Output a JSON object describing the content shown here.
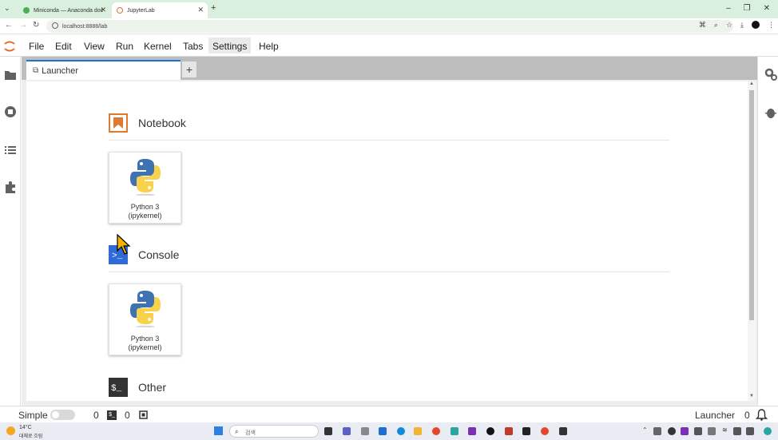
{
  "browser": {
    "tabs": [
      {
        "title": "Miniconda — Anaconda doc"
      },
      {
        "title": "JupyterLab"
      }
    ],
    "url": "localhost:8888/lab"
  },
  "menubar": {
    "items": [
      "File",
      "Edit",
      "View",
      "Run",
      "Kernel",
      "Tabs",
      "Settings",
      "Help"
    ]
  },
  "dock": {
    "tab_label": "Launcher",
    "add_tab": "+"
  },
  "launcher": {
    "sections": [
      {
        "title": "Notebook",
        "card": {
          "line1": "Python 3",
          "line2": "(ipykernel)"
        }
      },
      {
        "title": "Console",
        "card": {
          "line1": "Python 3",
          "line2": "(ipykernel)"
        }
      },
      {
        "title": "Other"
      }
    ],
    "console_glyph": ">_",
    "other_glyph": "$_"
  },
  "statusbar": {
    "mode_label": "Simple",
    "terminals_count": "0",
    "kernels_count": "0",
    "right_label": "Launcher",
    "notifications_count": "0"
  },
  "taskbar": {
    "weather_temp": "14°C",
    "weather_desc": "대체로 흐림",
    "search_placeholder": "검색"
  },
  "colors": {
    "notebook_orange": "#e07a2f",
    "console_blue": "#2f6bd8",
    "other_dark": "#333333",
    "accent": "#1976d2"
  }
}
